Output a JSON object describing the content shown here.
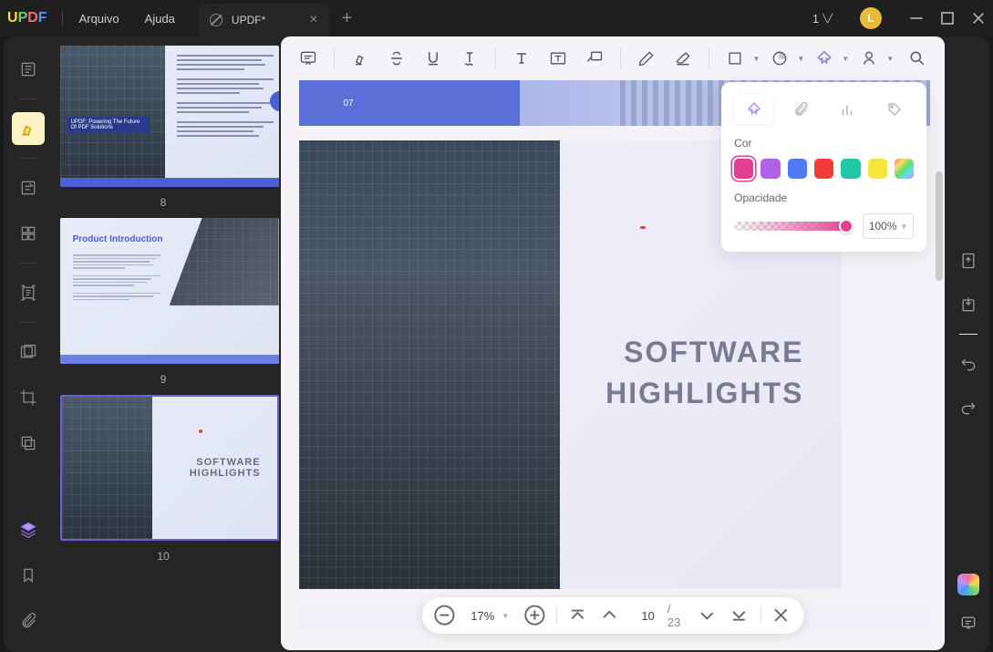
{
  "titlebar": {
    "menu": {
      "file": "Arquivo",
      "help": "Ajuda"
    },
    "tab_title": "UPDF*",
    "badge_count": "1",
    "avatar_letter": "L"
  },
  "thumbnails": [
    {
      "num": "8",
      "kind": "building-text",
      "banner": "UPDF: Powering The Future Of PDF Solutions"
    },
    {
      "num": "9",
      "kind": "intro",
      "title": "Product Introduction"
    },
    {
      "num": "10",
      "kind": "highlights",
      "title1": "SOFTWARE",
      "title2": "HIGHLIGHTS",
      "selected": true
    }
  ],
  "popup": {
    "color_label": "Cor",
    "opacity_label": "Opacidade",
    "opacity_value": "100%",
    "colors": [
      "#E33E91",
      "#B260E8",
      "#4E7CF5",
      "#F23C3C",
      "#1FC9A6",
      "#F5E63D",
      "gradient"
    ]
  },
  "page": {
    "prev_page_num": "07",
    "title_line1": "SOFTWARE",
    "title_line2": "HIGHLIGHTS"
  },
  "nav": {
    "zoom": "17%",
    "current_page": "10",
    "total_pages": "23"
  }
}
